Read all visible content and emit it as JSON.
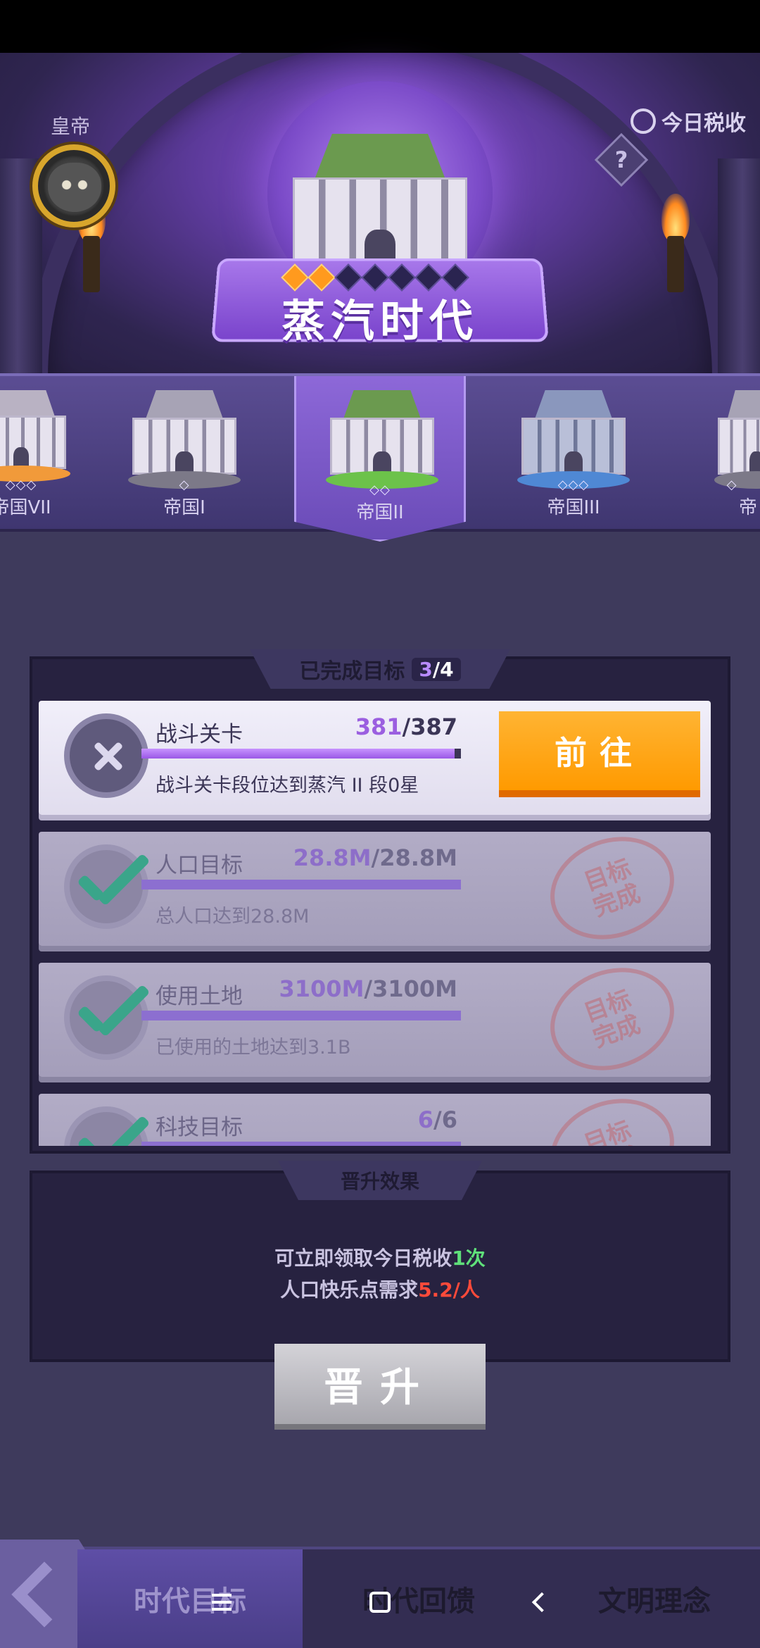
{
  "header": {
    "emperor_label": "皇帝",
    "tax_label": "今日税收",
    "help_symbol": "?",
    "era_title": "蒸汽时代",
    "stars_filled": 2,
    "stars_total": 7
  },
  "empire_tabs": [
    {
      "label": "帝国VII",
      "marks": "◇◇◇",
      "color": "orange"
    },
    {
      "label": "帝国I",
      "marks": "◇",
      "color": "grey"
    },
    {
      "label": "帝国II",
      "marks": "◇◇",
      "color": "green",
      "active": true
    },
    {
      "label": "帝国III",
      "marks": "◇◇◇",
      "color": "blue"
    },
    {
      "label": "帝",
      "marks": "◇",
      "color": "grey"
    }
  ],
  "objectives": {
    "title": "已完成目标",
    "count_done": "3",
    "count_total": "/4",
    "items": [
      {
        "name": "战斗关卡",
        "current": "381",
        "total": "/387",
        "progress": 0.98,
        "desc": "战斗关卡段位达到蒸汽 II 段0星",
        "done": false,
        "button": "前往"
      },
      {
        "name": "人口目标",
        "current": "28.8M",
        "total": "/28.8M",
        "progress": 1.0,
        "desc": "总人口达到28.8M",
        "done": true
      },
      {
        "name": "使用土地",
        "current": "3100M",
        "total": "/3100M",
        "progress": 1.0,
        "desc": "已使用的土地达到3.1B",
        "done": true
      },
      {
        "name": "科技目标",
        "current": "6",
        "total": "/6",
        "progress": 1.0,
        "desc": "",
        "done": true
      }
    ],
    "stamp_text": "目标完成"
  },
  "promotion": {
    "title": "晋升效果",
    "line1_prefix": "可立即领取今日税收",
    "line1_value": "1次",
    "line2_prefix": "人口快乐点需求",
    "line2_value": "5.2/人",
    "button": "晋升"
  },
  "bottom_nav": {
    "tab1": "时代目标",
    "tab2": "时代回馈",
    "tab3": "文明理念"
  },
  "colors": {
    "accent_purple": "#9b5fe0",
    "go_orange": "#ffa31a",
    "done_green": "#3aa58a",
    "value_green": "#5fe07a",
    "value_red": "#ff4a3a"
  }
}
